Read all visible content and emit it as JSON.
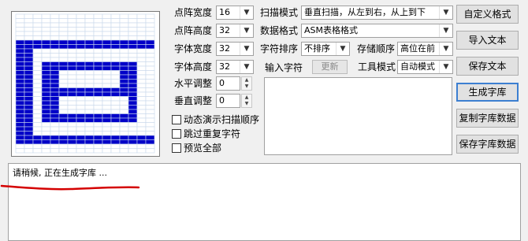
{
  "params": {
    "dot_width_label": "点阵宽度",
    "dot_width_value": "16",
    "dot_height_label": "点阵高度",
    "dot_height_value": "32",
    "font_width_label": "字体宽度",
    "font_width_value": "32",
    "font_height_label": "字体高度",
    "font_height_value": "32",
    "h_adjust_label": "水平调整",
    "h_adjust_value": "0",
    "v_adjust_label": "垂直调整",
    "v_adjust_value": "0"
  },
  "checkboxes": [
    {
      "label": "动态演示扫描顺序",
      "checked": false
    },
    {
      "label": "跳过重复字符",
      "checked": false
    },
    {
      "label": "预览全部",
      "checked": false
    }
  ],
  "scan": {
    "mode_label": "扫描模式",
    "mode_value": "垂直扫描，从左到右，从上到下",
    "format_label": "数据格式",
    "format_value": "ASM表格格式",
    "sort_label": "字符排序",
    "sort_value": "不排序",
    "order_label": "存储顺序",
    "order_value": "高位在前",
    "tool_label": "工具模式",
    "tool_value": "自动模式"
  },
  "input": {
    "label": "输入字符",
    "update_button": "更新",
    "value": ""
  },
  "buttons": {
    "custom_format": "自定义格式",
    "import_text": "导入文本",
    "save_text": "保存文本",
    "generate_lib": "生成字库",
    "copy_lib": "复制字库数据",
    "save_lib": "保存字库数据"
  },
  "log": {
    "text": "请稍候, 正在生成字库 ..."
  },
  "colors": {
    "pixel_on": "#0000c8",
    "grid_line": "#c8d8ec",
    "annotation": "#d40000"
  }
}
